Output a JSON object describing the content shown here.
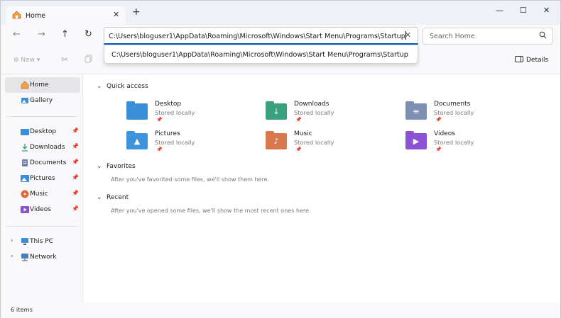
{
  "window": {
    "tab_title": "Home",
    "tab_close": "✕",
    "new_tab": "+",
    "controls": {
      "minimize": "—",
      "maximize": "☐",
      "close": "✕"
    }
  },
  "nav": {
    "back": "←",
    "forward": "→",
    "up": "↑",
    "refresh": "↻",
    "address_value": "C:\\Users\\bloguser1\\AppData\\Roaming\\Microsoft\\Windows\\Start Menu\\Programs\\Startup",
    "clear": "✕",
    "search_placeholder": "Search Home",
    "suggestion": "C:\\Users\\bloguser1\\AppData\\Roaming\\Microsoft\\Windows\\Start Menu\\Programs\\Startup"
  },
  "commandbar": {
    "new_label": "New",
    "details_label": "Details"
  },
  "sidebar": {
    "items": [
      {
        "label": "Home",
        "icon": "home-icon",
        "selected": true
      },
      {
        "label": "Gallery",
        "icon": "gallery-icon"
      }
    ],
    "pinned": [
      {
        "label": "Desktop",
        "icon": "desktop-folder-icon",
        "color": "#3a8fd8"
      },
      {
        "label": "Downloads",
        "icon": "download-icon",
        "color": "#3aa17e"
      },
      {
        "label": "Documents",
        "icon": "documents-icon",
        "color": "#6b7fa8"
      },
      {
        "label": "Pictures",
        "icon": "pictures-icon",
        "color": "#3a8fd8"
      },
      {
        "label": "Music",
        "icon": "music-icon",
        "color": "#e0673b"
      },
      {
        "label": "Videos",
        "icon": "videos-icon",
        "color": "#8a4fd8"
      }
    ],
    "tree": [
      {
        "label": "This PC",
        "icon": "computer-icon"
      },
      {
        "label": "Network",
        "icon": "network-icon"
      }
    ]
  },
  "main": {
    "quick_access": {
      "title": "Quick access",
      "items": [
        {
          "name": "Desktop",
          "sub": "Stored locally",
          "color": "#3a8fd8",
          "icon": "desktop-folder-icon"
        },
        {
          "name": "Downloads",
          "sub": "Stored locally",
          "color": "#3aa17e",
          "icon": "download-folder-icon"
        },
        {
          "name": "Documents",
          "sub": "Stored locally",
          "color": "#7d8fb3",
          "icon": "documents-folder-icon"
        },
        {
          "name": "Pictures",
          "sub": "Stored locally",
          "color": "#3d94dc",
          "icon": "pictures-folder-icon"
        },
        {
          "name": "Music",
          "sub": "Stored locally",
          "color": "#d8784c",
          "icon": "music-folder-icon"
        },
        {
          "name": "Videos",
          "sub": "Stored locally",
          "color": "#8c52d6",
          "icon": "videos-folder-icon"
        }
      ]
    },
    "favorites": {
      "title": "Favorites",
      "empty": "After you've favorited some files, we'll show them here."
    },
    "recent": {
      "title": "Recent",
      "empty": "After you've opened some files, we'll show the most recent ones here."
    }
  },
  "status": {
    "items": "6 items"
  }
}
